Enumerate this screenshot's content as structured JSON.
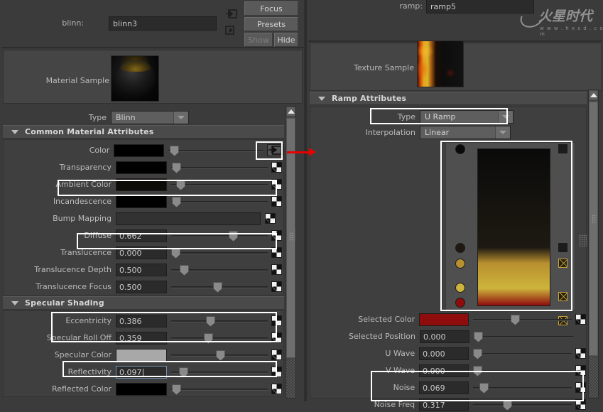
{
  "left_panel": {
    "node": {
      "label": "blinn:",
      "value": "blinn3",
      "placeholder": ""
    },
    "buttons": {
      "focus": "Focus",
      "presets": "Presets",
      "show": "Show",
      "hide": "Hide"
    },
    "sample": {
      "label": "Material Sample"
    },
    "type_row": {
      "label": "Type",
      "value": "Blinn"
    },
    "sections": [
      {
        "title": "Common Material Attributes"
      },
      {
        "title": "Specular Shading"
      }
    ],
    "common_attributes": [
      {
        "label": "Color",
        "kind": "color",
        "color": "#000000",
        "slider": 0.02,
        "map": "map-arrow",
        "highlight": false
      },
      {
        "label": "Transparency",
        "kind": "color",
        "color": "#000000",
        "slider": 0.01,
        "map": "checker",
        "highlight": false
      },
      {
        "label": "Ambient Color",
        "kind": "color",
        "color": "#0d0b07",
        "slider": 0.06,
        "map": "checker",
        "highlight": true
      },
      {
        "label": "Incandescence",
        "kind": "color",
        "color": "#000000",
        "slider": 0.01,
        "map": "checker",
        "highlight": false
      },
      {
        "label": "Bump Mapping",
        "kind": "long",
        "color": "#323232",
        "slider": null,
        "map": "checker",
        "highlight": false
      },
      {
        "label": "Diffuse",
        "kind": "value",
        "value": "0.662",
        "slider": 0.662,
        "map": "checker",
        "highlight": true
      },
      {
        "label": "Translucence",
        "kind": "value",
        "value": "0.000",
        "slider": 0.0,
        "map": "checker",
        "highlight": false
      },
      {
        "label": "Translucence Depth",
        "kind": "value",
        "value": "0.500",
        "slider": 0.1,
        "map": "checker",
        "highlight": false
      },
      {
        "label": "Translucence Focus",
        "kind": "value",
        "value": "0.500",
        "slider": 0.48,
        "map": "checker",
        "highlight": false
      }
    ],
    "specular_attributes": [
      {
        "label": "Eccentricity",
        "kind": "value",
        "value": "0.386",
        "slider": 0.4,
        "map": "checker",
        "highlight": true,
        "focused": false
      },
      {
        "label": "Specular Roll Off",
        "kind": "value",
        "value": "0.359",
        "slider": 0.38,
        "map": "checker",
        "highlight": true,
        "focused": false
      },
      {
        "label": "Specular Color",
        "kind": "color",
        "color": "#a8a8a8",
        "slider": 0.52,
        "map": "checker",
        "highlight": false,
        "focused": false
      },
      {
        "label": "Reflectivity",
        "kind": "value",
        "value": "0.097",
        "slider": 0.09,
        "map": "checker",
        "highlight": true,
        "focused": true
      },
      {
        "label": "Reflected Color",
        "kind": "color",
        "color": "#000000",
        "slider": 0.01,
        "map": "checker",
        "highlight": false,
        "focused": false
      }
    ],
    "scrollbar": {
      "up_arrow": "scroll-up"
    }
  },
  "right_panel": {
    "node": {
      "label": "ramp:",
      "value": "ramp5"
    },
    "sample": {
      "label": "Texture Sample"
    },
    "section": {
      "title": "Ramp Attributes"
    },
    "type_row": {
      "label": "Type",
      "value": "U Ramp"
    },
    "interp_row": {
      "label": "Interpolation",
      "value": "Linear"
    },
    "ramp_widget": {
      "stops": [
        {
          "position": 1.0,
          "color": "#0a0a0a",
          "delete": "solid"
        },
        {
          "position": 0.37,
          "color": "#1e1a12",
          "delete": "solid"
        },
        {
          "position": 0.27,
          "color": "#b9902f",
          "delete": "x"
        },
        {
          "position": 0.115,
          "color": "#cdb43c",
          "delete": "x"
        },
        {
          "position": 0.0,
          "color": "#8e0c0c",
          "delete": "x"
        }
      ]
    },
    "attributes": [
      {
        "label": "Selected Color",
        "kind": "color",
        "color": "#8e0c0c",
        "slider": 0.42,
        "map": "checker",
        "highlight": false
      },
      {
        "label": "Selected Position",
        "kind": "value",
        "value": "0.000",
        "slider": 0.0,
        "map": "none",
        "highlight": false
      },
      {
        "label": "U Wave",
        "kind": "value",
        "value": "0.000",
        "slider": 0.0,
        "map": "checker",
        "highlight": false
      },
      {
        "label": "V Wave",
        "kind": "value",
        "value": "0.000",
        "slider": 0.0,
        "map": "checker",
        "highlight": false
      },
      {
        "label": "Noise",
        "kind": "value",
        "value": "0.069",
        "slider": 0.07,
        "map": "checker",
        "highlight": true
      },
      {
        "label": "Noise Freq",
        "kind": "value",
        "value": "0.317",
        "slider": 0.33,
        "map": "checker",
        "highlight": true
      }
    ],
    "watermark": {
      "text": "火星时代",
      "sub": "w w w . h x s d . c o m"
    },
    "scrollbar": {
      "up_arrow": "scroll-up"
    }
  },
  "colors": {
    "panel_bg": "#3b3b3b",
    "field_bg": "#2b2b2b",
    "section_bg": "#4a4a4a",
    "highlight": "#ffffff",
    "annotation": "#e60000",
    "focus_border": "#6f93b5"
  }
}
